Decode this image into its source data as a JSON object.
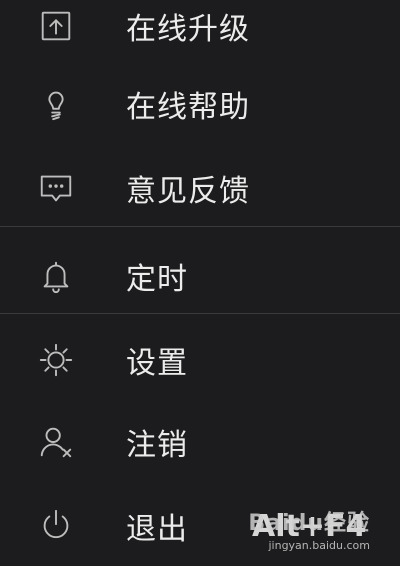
{
  "menu": {
    "items": [
      {
        "label": "在线升级",
        "icon": "upgrade-icon"
      },
      {
        "label": "在线帮助",
        "icon": "help-lightbulb-icon"
      },
      {
        "label": "意见反馈",
        "icon": "feedback-chat-icon"
      },
      {
        "label": "定时",
        "icon": "bell-icon"
      },
      {
        "label": "设置",
        "icon": "gear-icon"
      },
      {
        "label": "注销",
        "icon": "user-logout-icon"
      },
      {
        "label": "退出",
        "icon": "power-icon",
        "shortcut": "Alt+F4"
      }
    ]
  },
  "watermark": {
    "logo": "Baidu经验",
    "url": "jingyan.baidu.com"
  },
  "colors": {
    "background": "#1c1c1e",
    "text": "#ececec",
    "icon": "#bdbdbd",
    "divider": "#3a3a3c"
  }
}
